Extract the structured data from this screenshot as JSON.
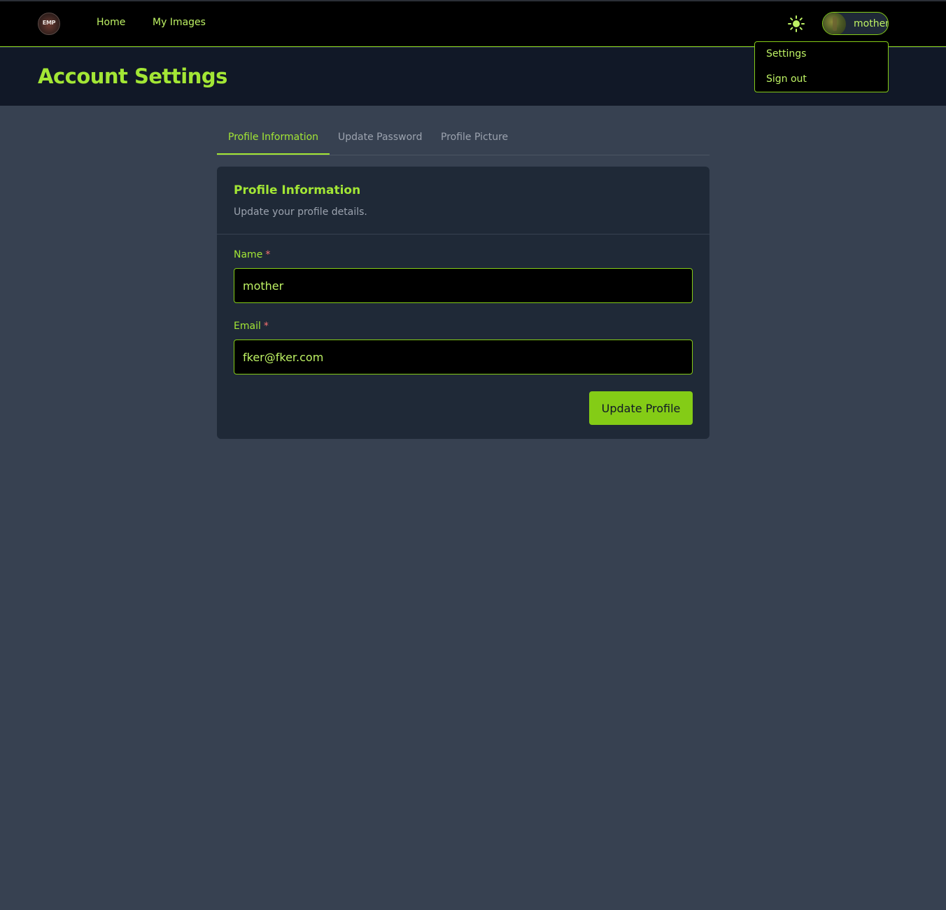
{
  "navbar": {
    "logo_text": "EMP",
    "links": [
      {
        "label": "Home"
      },
      {
        "label": "My Images"
      }
    ],
    "user": {
      "name": "mother"
    }
  },
  "dropdown": {
    "items": [
      {
        "label": "Settings"
      },
      {
        "label": "Sign out"
      }
    ]
  },
  "page": {
    "title": "Account Settings"
  },
  "tabs": [
    {
      "label": "Profile Information",
      "active": true
    },
    {
      "label": "Update Password",
      "active": false
    },
    {
      "label": "Profile Picture",
      "active": false
    }
  ],
  "card": {
    "title": "Profile Information",
    "subtitle": "Update your profile details.",
    "fields": {
      "name": {
        "label": "Name",
        "required_mark": "*",
        "value": "mother"
      },
      "email": {
        "label": "Email",
        "required_mark": "*",
        "value": "fker@fker.com"
      }
    },
    "submit_label": "Update Profile"
  },
  "icons": {
    "theme_toggle": "sun-icon",
    "avatar": "user-avatar-image"
  },
  "colors": {
    "accent": "#a3e635",
    "accent_dark": "#84cc16",
    "navbar_bg": "#000000",
    "header_bg": "#111827",
    "page_bg": "#374151",
    "card_bg": "#1f2937",
    "required": "#f87171",
    "muted_text": "#9ca3af"
  }
}
